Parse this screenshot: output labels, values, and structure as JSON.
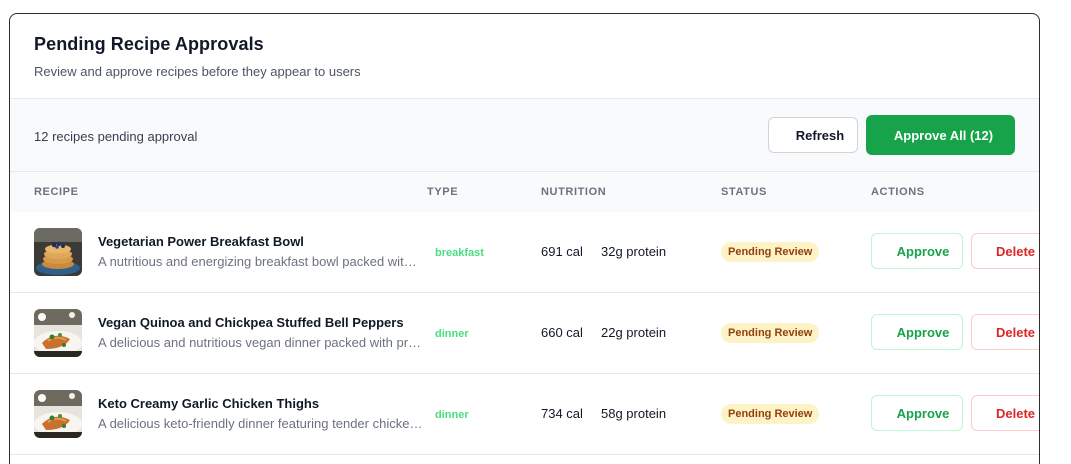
{
  "header": {
    "title": "Pending Recipe Approvals",
    "subtitle": "Review and approve recipes before they appear to users"
  },
  "toolbar": {
    "pending_text": "12 recipes pending approval",
    "refresh_label": "Refresh",
    "approve_all_label": "Approve All (12)"
  },
  "table": {
    "columns": [
      "RECIPE",
      "TYPE",
      "NUTRITION",
      "STATUS",
      "ACTIONS"
    ],
    "rows": [
      {
        "name": "Vegetarian Power Breakfast Bowl",
        "description": "A nutritious and energizing breakfast bowl packed with wholesome ingredients",
        "type": "breakfast",
        "calories": "691 cal",
        "protein": "32g protein",
        "status": "Pending Review",
        "approve_label": "Approve",
        "delete_label": "Delete",
        "image": "pancake-stack-photo"
      },
      {
        "name": "Vegan Quinoa and Chickpea Stuffed Bell Peppers",
        "description": "A delicious and nutritious vegan dinner packed with protein and fiber",
        "type": "dinner",
        "calories": "660 cal",
        "protein": "22g protein",
        "status": "Pending Review",
        "approve_label": "Approve",
        "delete_label": "Delete",
        "image": "plated-dinner-photo"
      },
      {
        "name": "Keto Creamy Garlic Chicken Thighs",
        "description": "A delicious keto-friendly dinner featuring tender chicken thighs",
        "type": "dinner",
        "calories": "734 cal",
        "protein": "58g protein",
        "status": "Pending Review",
        "approve_label": "Approve",
        "delete_label": "Delete",
        "image": "plated-dinner-photo"
      }
    ]
  },
  "colors": {
    "accent_green": "#16a34a",
    "type_green": "#4ade80",
    "pending_bg": "#fef3c7",
    "pending_text": "#92400e",
    "delete_red": "#dc2626"
  }
}
